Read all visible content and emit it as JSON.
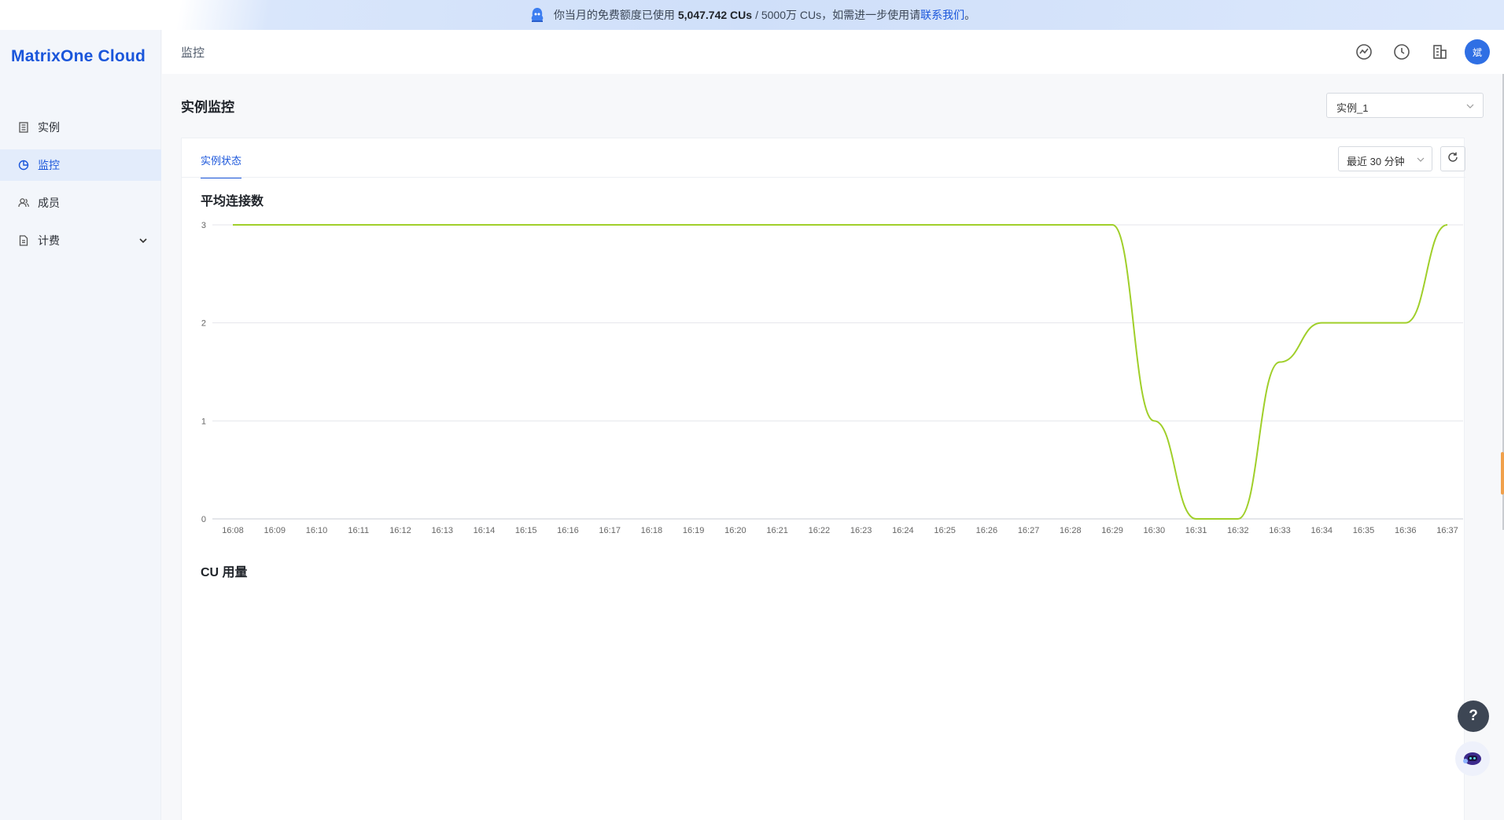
{
  "banner": {
    "prefix": "你当月的免费额度已使用",
    "used": "5,047.742 CUs",
    "quota": "/ 5000万 CUs，如需进一步使用请",
    "link": "联系我们",
    "suffix": "。"
  },
  "sidebar": {
    "logo": "MatrixOne Cloud",
    "items": [
      {
        "label": "实例",
        "icon": "instance-icon"
      },
      {
        "label": "监控",
        "icon": "monitor-icon",
        "active": true
      },
      {
        "label": "成员",
        "icon": "members-icon"
      },
      {
        "label": "计费",
        "icon": "billing-icon",
        "expandable": true
      }
    ]
  },
  "header": {
    "breadcrumb": "监控",
    "avatar": "斌",
    "icons": [
      "dashboard-icon",
      "history-icon",
      "organization-icon"
    ]
  },
  "page": {
    "title": "实例监控",
    "instance_select": "实例_1",
    "tab": "实例状态",
    "time_range": "最近 30 分钟",
    "section1": "平均连接数",
    "section2": "CU 用量"
  },
  "colors": {
    "accent": "#1a56db",
    "line": "#a0cf2a"
  },
  "chart_data": {
    "type": "line",
    "title": "平均连接数",
    "x": [
      "16:08",
      "16:09",
      "16:10",
      "16:11",
      "16:12",
      "16:13",
      "16:14",
      "16:15",
      "16:16",
      "16:17",
      "16:18",
      "16:19",
      "16:20",
      "16:21",
      "16:22",
      "16:23",
      "16:24",
      "16:25",
      "16:26",
      "16:27",
      "16:28",
      "16:29",
      "16:30",
      "16:31",
      "16:32",
      "16:33",
      "16:34",
      "16:35",
      "16:36",
      "16:37"
    ],
    "series": [
      {
        "values": [
          3,
          3,
          3,
          3,
          3,
          3,
          3,
          3,
          3,
          3,
          3,
          3,
          3,
          3,
          3,
          3,
          3,
          3,
          3,
          3,
          3,
          3,
          1,
          0,
          0,
          1.6,
          2,
          2,
          2,
          3
        ]
      }
    ],
    "yticks": [
      0,
      1,
      2,
      3
    ],
    "ylim": [
      0,
      3
    ],
    "grid": true
  }
}
